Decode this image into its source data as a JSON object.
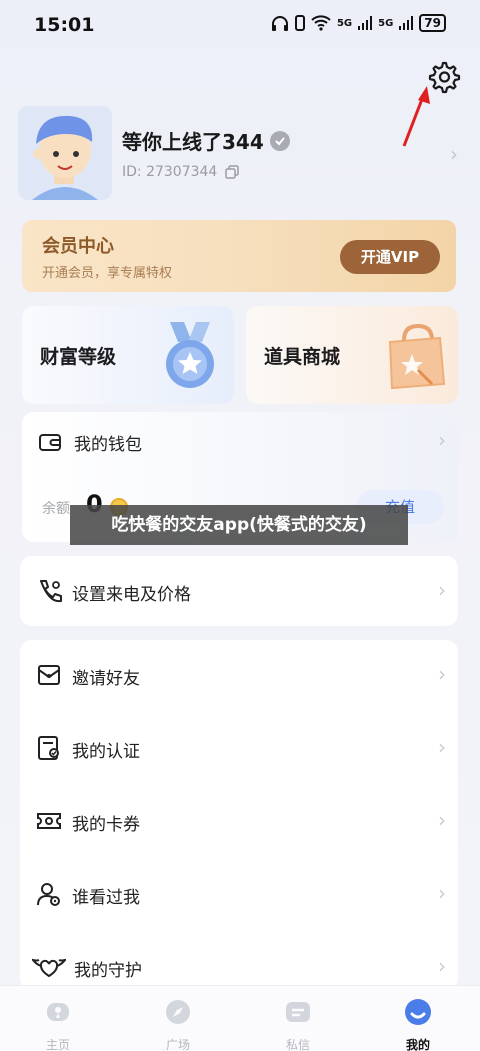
{
  "status_bar": {
    "time": "15:01",
    "network_1": "5G",
    "network_2": "5G",
    "battery": "79"
  },
  "profile": {
    "username": "等你上线了344",
    "user_id": "ID: 27307344"
  },
  "vip": {
    "title": "会员中心",
    "subtitle": "开通会员，享专属特权",
    "button": "开通VIP"
  },
  "tiles": {
    "wealth": "财富等级",
    "shop": "道具商城"
  },
  "wallet": {
    "title": "我的钱包",
    "balance_label": "余额",
    "balance_value": "0",
    "recharge": "充值"
  },
  "overlay_banner": "吃快餐的交友app(快餐式的交友)",
  "call_settings": {
    "label": "设置来电及价格"
  },
  "menu": {
    "items": [
      {
        "label": "邀请好友",
        "icon": "invite-icon"
      },
      {
        "label": "我的认证",
        "icon": "certification-icon"
      },
      {
        "label": "我的卡券",
        "icon": "coupon-icon"
      },
      {
        "label": "谁看过我",
        "icon": "visitors-icon"
      },
      {
        "label": "我的守护",
        "icon": "guardian-icon"
      }
    ]
  },
  "tabbar": {
    "tabs": [
      {
        "label": "主页",
        "icon": "home-icon",
        "active": false
      },
      {
        "label": "广场",
        "icon": "plaza-icon",
        "active": false
      },
      {
        "label": "私信",
        "icon": "message-icon",
        "active": false
      },
      {
        "label": "我的",
        "icon": "profile-icon",
        "active": true
      }
    ]
  },
  "colors": {
    "accent": "#4a7de8",
    "vip_brown": "#9c6438",
    "annotation_red": "#e02020"
  }
}
